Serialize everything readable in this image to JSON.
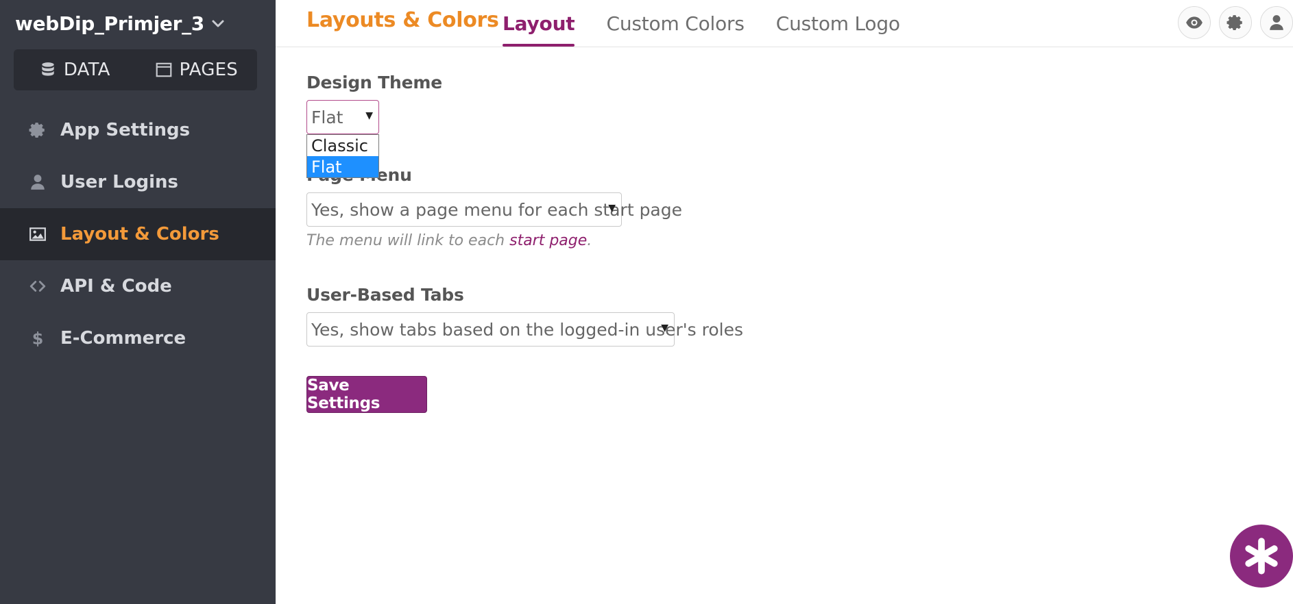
{
  "app": {
    "name": "webDip_Primjer_3"
  },
  "mode_switch": {
    "data_label": "DATA",
    "pages_label": "PAGES"
  },
  "sidebar": {
    "items": [
      {
        "label": "App Settings",
        "icon": "gear-icon"
      },
      {
        "label": "User Logins",
        "icon": "user-icon"
      },
      {
        "label": "Layout & Colors",
        "icon": "image-icon",
        "active": true
      },
      {
        "label": "API & Code",
        "icon": "code-icon"
      },
      {
        "label": "E-Commerce",
        "icon": "dollar-icon"
      }
    ]
  },
  "header": {
    "title": "Layouts & Colors",
    "tabs": [
      {
        "label": "Layout",
        "active": true
      },
      {
        "label": "Custom Colors"
      },
      {
        "label": "Custom Logo"
      }
    ]
  },
  "form": {
    "design_theme": {
      "label": "Design Theme",
      "value": "Flat",
      "options": [
        "Classic",
        "Flat"
      ],
      "selected_option": "Flat"
    },
    "page_menu": {
      "label": "Page Menu",
      "value": "Yes, show a page menu for each start page",
      "help_prefix": "The menu will link to each ",
      "help_link": "start page",
      "help_suffix": "."
    },
    "user_tabs": {
      "label": "User-Based Tabs",
      "value": "Yes, show tabs based on the logged-in user's roles"
    },
    "save_label": "Save Settings"
  },
  "colors": {
    "sidebar_bg": "#373a43",
    "accent_orange": "#ec8a24",
    "accent_purple": "#8e1f6d",
    "button_purple": "#8b2a7e",
    "dropdown_highlight": "#1e90ff"
  }
}
